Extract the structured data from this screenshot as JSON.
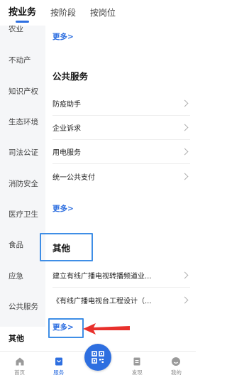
{
  "top_tabs": [
    {
      "label": "按业务"
    },
    {
      "label": "按阶段"
    },
    {
      "label": "按岗位"
    }
  ],
  "sidebar": {
    "items": [
      {
        "label": "农业"
      },
      {
        "label": "不动产"
      },
      {
        "label": "知识产权"
      },
      {
        "label": "生态环境"
      },
      {
        "label": "司法公证"
      },
      {
        "label": "消防安全"
      },
      {
        "label": "医疗卫生"
      },
      {
        "label": "食品"
      },
      {
        "label": "应急"
      },
      {
        "label": "公共服务"
      },
      {
        "label": "其他"
      }
    ],
    "active_index": 10
  },
  "content": {
    "prev_more": "更多>",
    "public_service": {
      "title": "公共服务",
      "items": [
        {
          "label": "防疫助手"
        },
        {
          "label": "企业诉求"
        },
        {
          "label": "用电服务"
        },
        {
          "label": "统一公共支付"
        }
      ],
      "more": "更多>"
    },
    "other": {
      "title": "其他",
      "items": [
        {
          "label": "建立有线广播电视转播频道业..."
        },
        {
          "label": "《有线广播电视台工程设计（..."
        }
      ],
      "more": "更多>"
    }
  },
  "bottom_nav": {
    "items": [
      {
        "label": "首页",
        "icon": "home-icon"
      },
      {
        "label": "服务",
        "icon": "service-icon"
      },
      {
        "label": "",
        "icon": "qr-scan-icon"
      },
      {
        "label": "发现",
        "icon": "discover-icon"
      },
      {
        "label": "我的",
        "icon": "profile-icon"
      }
    ],
    "active_index": 1
  },
  "colors": {
    "accent": "#2e6fe0",
    "highlight_box": "#3f8ee6",
    "annotation_arrow": "#e8302c",
    "sidebar_bg": "#f5f6f8"
  }
}
